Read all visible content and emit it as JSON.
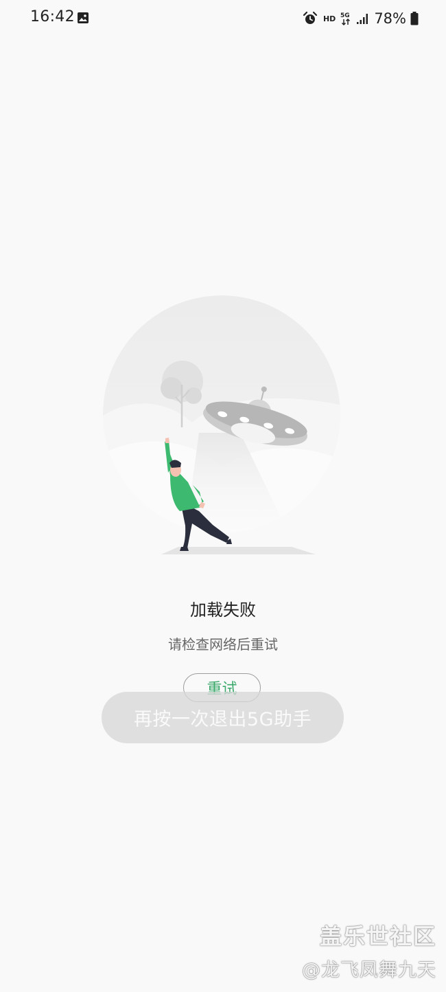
{
  "status_bar": {
    "time": "16:42",
    "hd": "HD",
    "battery": "78%",
    "icons": [
      "gallery-icon",
      "alarm-icon",
      "5g-network-icon",
      "signal-icon",
      "battery-icon"
    ]
  },
  "illustration": {
    "name": "ufo-network-error-illustration",
    "accent_color": "#3dba6f"
  },
  "error": {
    "title": "加载失败",
    "subtitle": "请检查网络后重试",
    "retry_label": "重试",
    "retry_color": "#3aa96a"
  },
  "toast": {
    "text": "再按一次退出5G助手"
  },
  "watermark": {
    "line1": "盖乐世社区",
    "line2": "@龙飞凤舞九天"
  }
}
